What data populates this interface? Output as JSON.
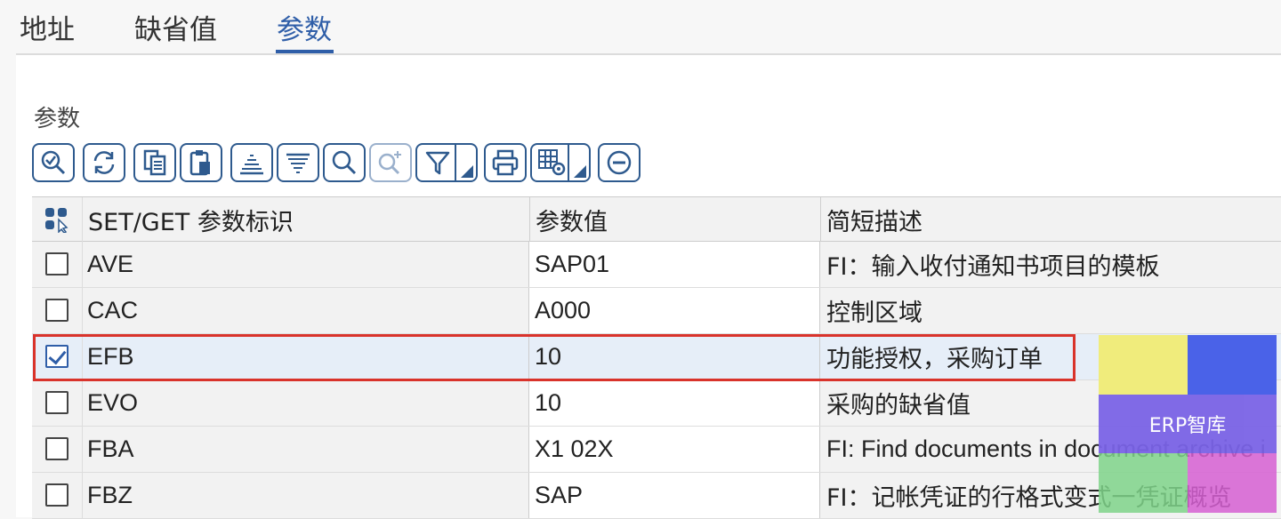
{
  "tabs": [
    {
      "label": "地址"
    },
    {
      "label": "缺省值"
    },
    {
      "label": "参数"
    }
  ],
  "active_tab": "参数",
  "section_title": "参数",
  "toolbar": {
    "icons": [
      "zoom-check-icon",
      "refresh-icon",
      "copy-icon",
      "paste-icon",
      "sort-ascending-icon",
      "sort-descending-icon",
      "search-icon",
      "search-next-icon",
      "filter-icon",
      "print-icon",
      "layout-settings-icon",
      "remove-row-icon"
    ]
  },
  "table": {
    "headers": {
      "id": "SET/GET 参数标识",
      "value": "参数值",
      "desc": "简短描述"
    },
    "rows": [
      {
        "id": "AVE",
        "value": "SAP01",
        "desc": "FI：输入收付通知书项目的模板",
        "checked": false
      },
      {
        "id": "CAC",
        "value": "A000",
        "desc": "控制区域",
        "checked": false
      },
      {
        "id": "EFB",
        "value": "10",
        "desc": "功能授权，采购订单",
        "checked": true
      },
      {
        "id": "EVO",
        "value": "10",
        "desc": "采购的缺省值",
        "checked": false
      },
      {
        "id": "FBA",
        "value": "X1 02X",
        "desc": "FI: Find documents in document archive i",
        "checked": false
      },
      {
        "id": "FBZ",
        "value": "SAP",
        "desc": "FI：记帐凭证的行格式变式一凭证概览",
        "checked": false
      }
    ]
  },
  "watermark": {
    "text": "ERP智库"
  },
  "colors": {
    "accent": "#2f5ea8",
    "highlight": "#d9332b"
  }
}
